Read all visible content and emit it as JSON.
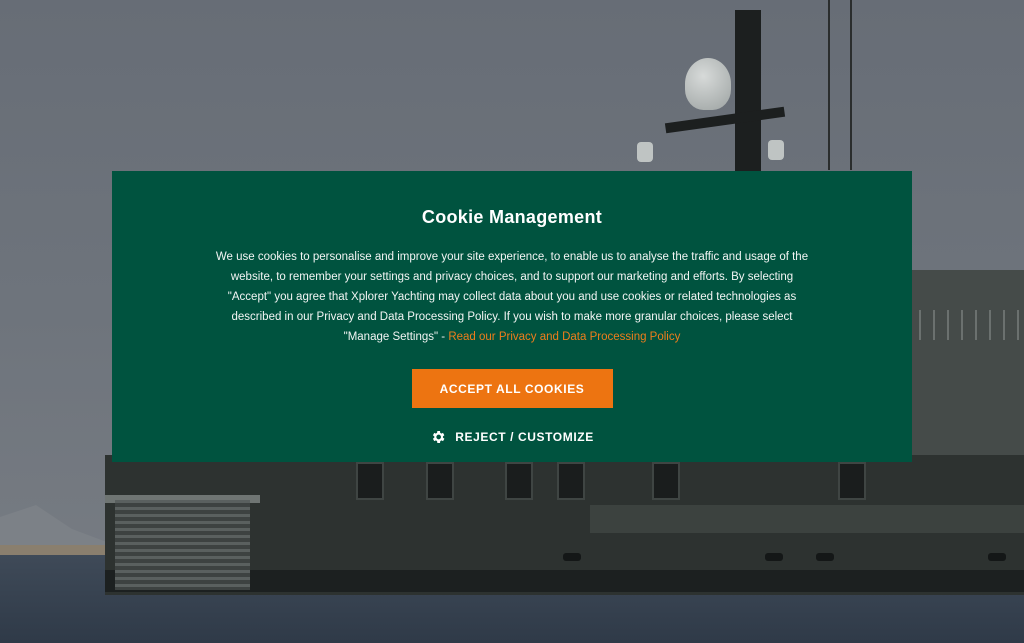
{
  "cookie_modal": {
    "title": "Cookie Management",
    "body": "We use cookies to personalise and improve your site experience, to enable us to analyse the traffic and usage of the website, to remember your settings and privacy choices, and to support our marketing and efforts. By selecting \"Accept\" you agree that Xplorer Yachting may collect data about you and use cookies or related technologies as described in our Privacy and Data Processing Policy. If you wish to make more granular choices, please select \"Manage Settings\" - ",
    "policy_link": "Read our Privacy and Data Processing Policy",
    "accept_label": "ACCEPT ALL COOKIES",
    "reject_label": "REJECT / CUSTOMIZE",
    "reject_icon": "gear-icon"
  },
  "colors": {
    "modal_bg": "#00533f",
    "accent": "#ed7411",
    "link": "#ee7d1c"
  },
  "background": {
    "image": "yacht-photo"
  }
}
